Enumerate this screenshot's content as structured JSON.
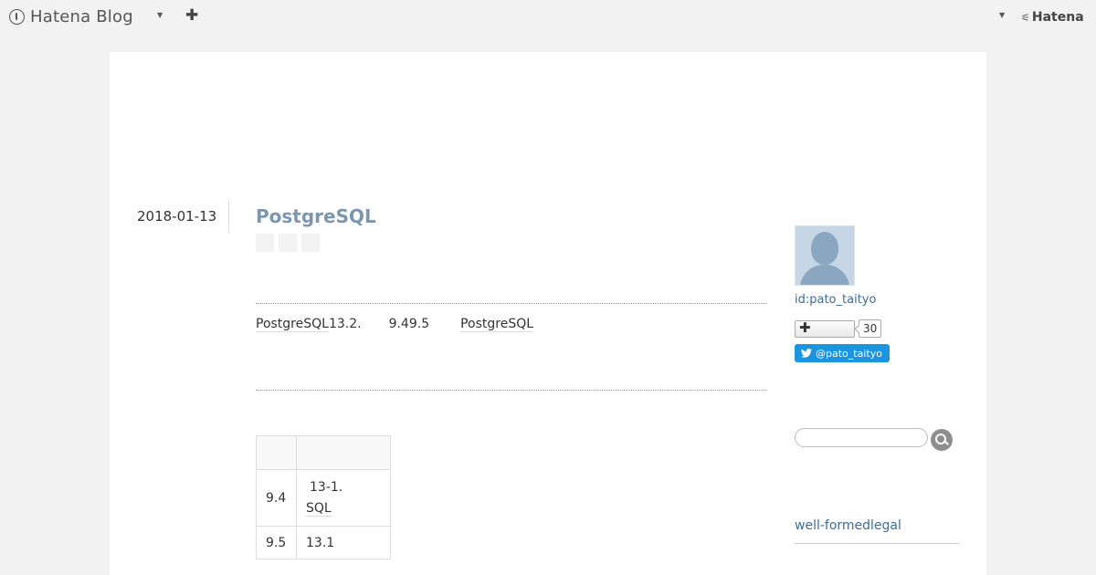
{
  "header": {
    "logo_text": "Hatena Blog",
    "hatena_label": "Hatena"
  },
  "entry": {
    "date": "2018-01-13",
    "title": "PostgreSQL",
    "line_kw1": "PostgreSQL",
    "line_text1": "13.2.",
    "line_text2": "9.49.5",
    "line_kw2": "PostgreSQL",
    "table": {
      "headers": [
        "",
        ""
      ],
      "rows": [
        {
          "version": "9.4",
          "line1": "13-1.",
          "line2": "SQL"
        },
        {
          "version": "9.5",
          "line1": "13.1"
        }
      ]
    }
  },
  "sidebar": {
    "user_id": "id:pato_taityo",
    "follow_count": "30",
    "twitter_label": "@pato_taityo",
    "search_placeholder": "",
    "link_text": "well-formedlegal"
  },
  "colors": {
    "title": "#7a96b0",
    "link": "#3b6d9c",
    "twitter": "#1b95e0",
    "background": "#f2f2f2"
  },
  "icons": [
    "hatena-blog-logo-icon",
    "caret-down-icon",
    "plus-icon",
    "hatena-icon",
    "share-icon",
    "avatar-icon",
    "twitter-bird-icon",
    "search-icon"
  ]
}
